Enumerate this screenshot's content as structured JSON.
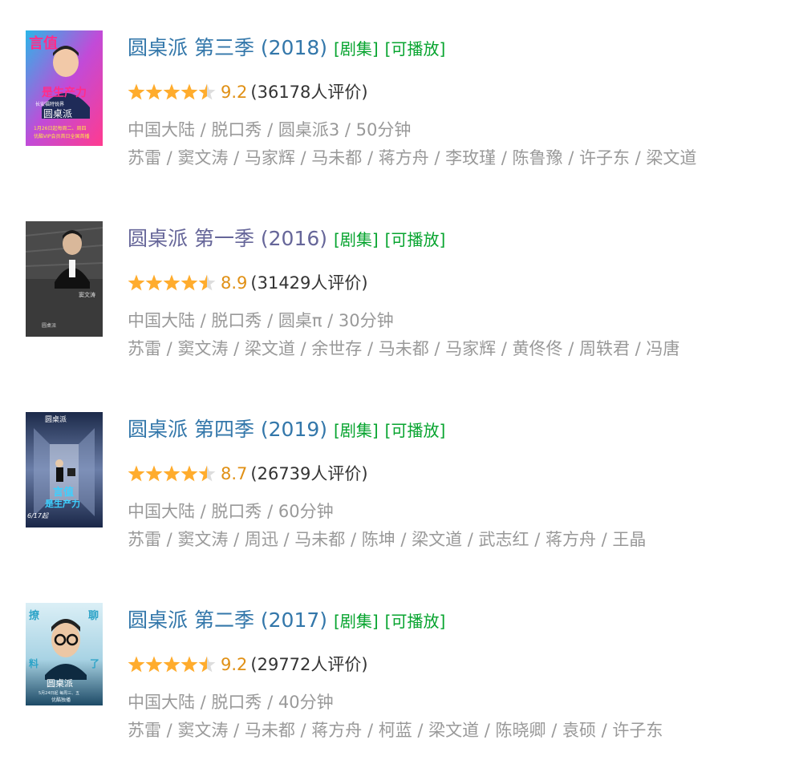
{
  "colors": {
    "title_link": "#3377aa",
    "title_link_visited": "#666699",
    "tag_green": "#07a42f",
    "score_orange": "#e09015",
    "star_gold": "#ffac2d",
    "star_gray": "#dddddd",
    "meta_gray": "#999999"
  },
  "results": [
    {
      "title": "圆桌派 第三季 (2018)",
      "visited": false,
      "tags": [
        "[剧集]",
        "[可播放]"
      ],
      "stars": 4.5,
      "score": "9.2",
      "votes": "(36178人评价)",
      "meta": "中国大陆 / 脱口秀 / 圆桌派3 / 50分钟",
      "cast": "苏雷 / 窦文涛 / 马家辉 / 马未都 / 蒋方舟 / 李玫瑾 / 陈鲁豫 / 许子东 / 梁文道",
      "poster": {
        "icon": "poster-season3-image",
        "texts": [
          "言值",
          "是生产力",
          "圆桌派",
          "长安福特锐界",
          "1月26日起每周二、周四",
          "优酷VIP会员首日全国首播"
        ]
      }
    },
    {
      "title": "圆桌派 第一季 (2016)",
      "visited": true,
      "tags": [
        "[剧集]",
        "[可播放]"
      ],
      "stars": 4.5,
      "score": "8.9",
      "votes": "(31429人评价)",
      "meta": "中国大陆 / 脱口秀 / 圆桌π / 30分钟",
      "cast": "苏雷 / 窦文涛 / 梁文道 / 余世存 / 马未都 / 马家辉 / 黄佟佟 / 周轶君 / 冯唐",
      "poster": {
        "icon": "poster-season1-image",
        "texts": [
          "窦文涛",
          "圆桌派"
        ]
      }
    },
    {
      "title": "圆桌派 第四季 (2019)",
      "visited": false,
      "tags": [
        "[剧集]",
        "[可播放]"
      ],
      "stars": 4.5,
      "score": "8.7",
      "votes": "(26739人评价)",
      "meta": "中国大陆 / 脱口秀 / 60分钟",
      "cast": "苏雷 / 窦文涛 / 周迅 / 马未都 / 陈坤 / 梁文道 / 武志红 / 蒋方舟 / 王晶",
      "poster": {
        "icon": "poster-season4-image",
        "texts": [
          "圆桌派",
          "言值",
          "是生产力",
          "6/17起"
        ]
      }
    },
    {
      "title": "圆桌派 第二季 (2017)",
      "visited": false,
      "tags": [
        "[剧集]",
        "[可播放]"
      ],
      "stars": 4.5,
      "score": "9.2",
      "votes": "(29772人评价)",
      "meta": "中国大陆 / 脱口秀 / 40分钟",
      "cast": "苏雷 / 窦文涛 / 马未都 / 蒋方舟 / 柯蓝 / 梁文道 / 陈晓卿 / 袁硕 / 许子东",
      "poster": {
        "icon": "poster-season2-image",
        "texts": [
          "撩",
          "聊",
          "料",
          "了",
          "圆桌派",
          "5月24日起 每周三、五",
          "优酷独播"
        ]
      }
    }
  ]
}
